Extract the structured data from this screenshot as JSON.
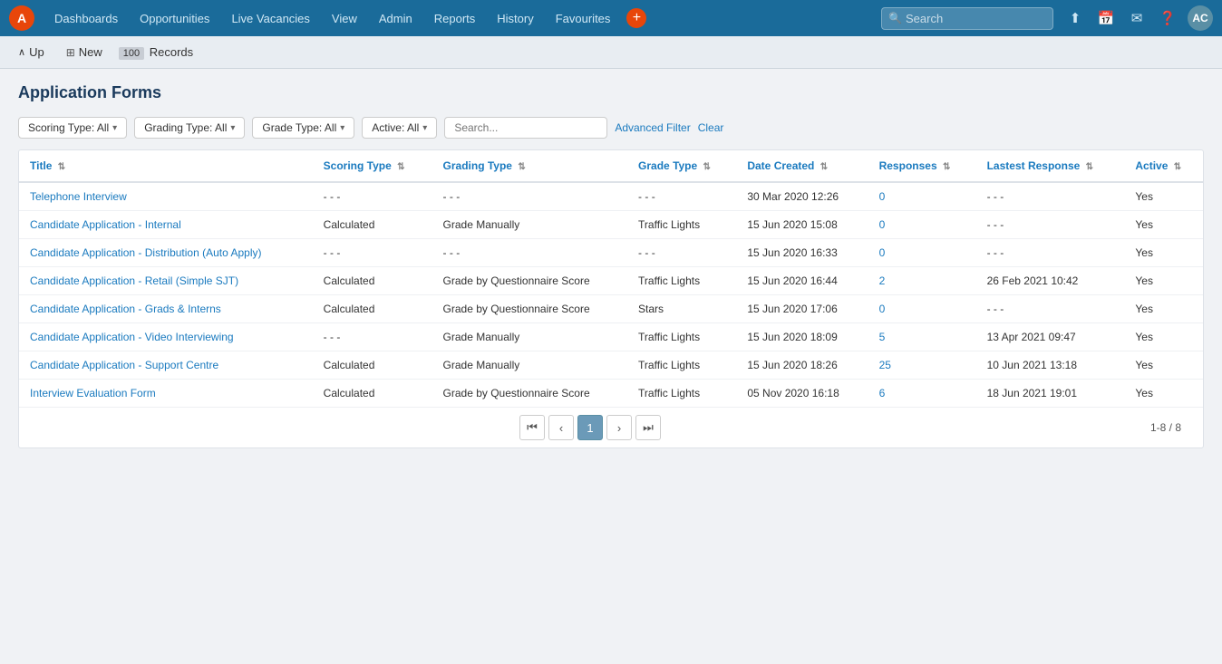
{
  "nav": {
    "logo": "A",
    "items": [
      "Dashboards",
      "Opportunities",
      "Live Vacancies",
      "View",
      "Admin",
      "Reports",
      "History",
      "Favourites"
    ],
    "plus_label": "+",
    "search_placeholder": "Search",
    "avatar": "AC",
    "icons": [
      "upload",
      "calendar",
      "email",
      "help"
    ]
  },
  "toolbar": {
    "up_label": "Up",
    "new_label": "New",
    "records_count": "100",
    "records_label": "Records"
  },
  "page": {
    "title": "Application Forms"
  },
  "filters": {
    "scoring_type": "Scoring Type: All",
    "grading_type": "Grading Type: All",
    "grade_type": "Grade Type: All",
    "active": "Active: All",
    "search_placeholder": "Search...",
    "advanced_filter": "Advanced Filter",
    "clear": "Clear"
  },
  "table": {
    "columns": [
      {
        "id": "title",
        "label": "Title"
      },
      {
        "id": "scoring_type",
        "label": "Scoring Type"
      },
      {
        "id": "grading_type",
        "label": "Grading Type"
      },
      {
        "id": "grade_type",
        "label": "Grade Type"
      },
      {
        "id": "date_created",
        "label": "Date Created"
      },
      {
        "id": "responses",
        "label": "Responses"
      },
      {
        "id": "lastest_response",
        "label": "Lastest Response"
      },
      {
        "id": "active",
        "label": "Active"
      }
    ],
    "rows": [
      {
        "title": "Telephone Interview",
        "scoring_type": "- - -",
        "grading_type": "- - -",
        "grade_type": "- - -",
        "date_created": "30 Mar 2020 12:26",
        "responses": "0",
        "lastest_response": "- - -",
        "active": "Yes"
      },
      {
        "title": "Candidate Application - Internal",
        "scoring_type": "Calculated",
        "grading_type": "Grade Manually",
        "grade_type": "Traffic Lights",
        "date_created": "15 Jun 2020 15:08",
        "responses": "0",
        "lastest_response": "- - -",
        "active": "Yes"
      },
      {
        "title": "Candidate Application - Distribution (Auto Apply)",
        "scoring_type": "- - -",
        "grading_type": "- - -",
        "grade_type": "- - -",
        "date_created": "15 Jun 2020 16:33",
        "responses": "0",
        "lastest_response": "- - -",
        "active": "Yes"
      },
      {
        "title": "Candidate Application - Retail (Simple SJT)",
        "scoring_type": "Calculated",
        "grading_type": "Grade by Questionnaire Score",
        "grade_type": "Traffic Lights",
        "date_created": "15 Jun 2020 16:44",
        "responses": "2",
        "lastest_response": "26 Feb 2021 10:42",
        "active": "Yes"
      },
      {
        "title": "Candidate Application - Grads & Interns",
        "scoring_type": "Calculated",
        "grading_type": "Grade by Questionnaire Score",
        "grade_type": "Stars",
        "date_created": "15 Jun 2020 17:06",
        "responses": "0",
        "lastest_response": "- - -",
        "active": "Yes"
      },
      {
        "title": "Candidate Application - Video Interviewing",
        "scoring_type": "- - -",
        "grading_type": "Grade Manually",
        "grade_type": "Traffic Lights",
        "date_created": "15 Jun 2020 18:09",
        "responses": "5",
        "lastest_response": "13 Apr 2021 09:47",
        "active": "Yes"
      },
      {
        "title": "Candidate Application - Support Centre",
        "scoring_type": "Calculated",
        "grading_type": "Grade Manually",
        "grade_type": "Traffic Lights",
        "date_created": "15 Jun 2020 18:26",
        "responses": "25",
        "lastest_response": "10 Jun 2021 13:18",
        "active": "Yes"
      },
      {
        "title": "Interview Evaluation Form",
        "scoring_type": "Calculated",
        "grading_type": "Grade by Questionnaire Score",
        "grade_type": "Traffic Lights",
        "date_created": "05 Nov 2020 16:18",
        "responses": "6",
        "lastest_response": "18 Jun 2021 19:01",
        "active": "Yes"
      }
    ]
  },
  "pagination": {
    "current_page": "1",
    "page_range": "1-8 / 8"
  }
}
